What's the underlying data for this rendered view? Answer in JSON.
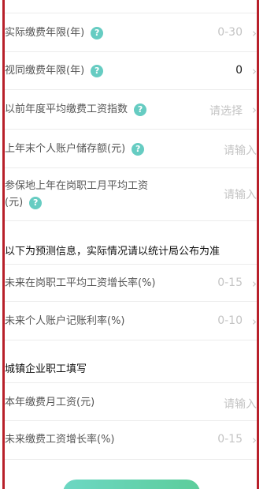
{
  "rows": [
    {
      "label": "实际缴费年限(年)",
      "value": "0-30",
      "filled": false,
      "has_help": true
    },
    {
      "label": "视同缴费年限(年)",
      "value": "0",
      "filled": true,
      "has_help": true
    },
    {
      "label": "以前年度平均缴费工资指数",
      "value": "请选择",
      "filled": false,
      "has_help": true
    },
    {
      "label": "上年末个人账户储存额(元)",
      "value": "请输入",
      "filled": false,
      "has_help": true
    },
    {
      "label_line1": "参保地上年在岗职工月平均工资",
      "label_line2": "(元)",
      "value": "请输入",
      "filled": false,
      "has_help": true
    },
    {
      "label": "未来在岗职工平均工资增长率(%)",
      "value": "0-15",
      "filled": false,
      "has_help": false
    },
    {
      "label": "未来个人账户记账利率(%)",
      "value": "0-10",
      "filled": false,
      "has_help": false
    },
    {
      "label": "本年缴费月工资(元)",
      "value": "请输入",
      "filled": false,
      "has_help": false
    },
    {
      "label": "未来缴费工资增长率(%)",
      "value": "0-15",
      "filled": false,
      "has_help": false
    }
  ],
  "sections": {
    "forecast_note": "以下为预测信息，实际情况请以统计局公布为准",
    "urban_employee": "城镇企业职工填写"
  },
  "icons": {
    "help": "help-circle-icon",
    "chevron": "chevron-right-icon"
  },
  "colors": {
    "help_icon": "#66ccc2",
    "border": "#b8202a",
    "button_gradient_start": "#6dd7c3",
    "button_gradient_end": "#5ccd9b"
  }
}
